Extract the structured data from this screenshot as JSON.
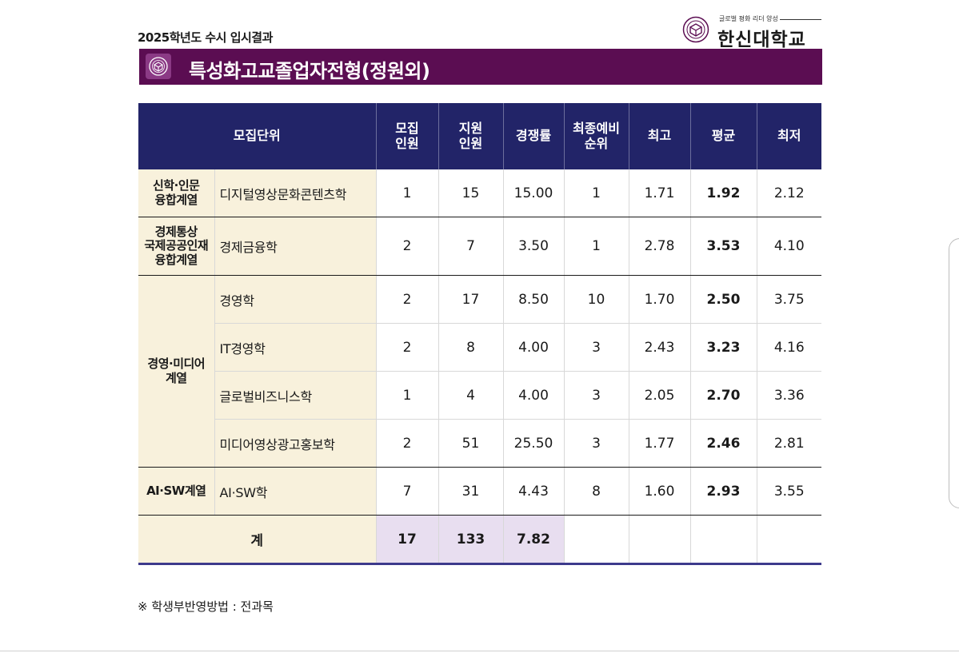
{
  "header": {
    "title": "2025학년도 수시 입시결과",
    "logo_slogan": "글로벌 평화 리더 양성",
    "logo_name": "한신대학교"
  },
  "banner": {
    "title": "특성화고교졸업자전형(정원외)"
  },
  "table": {
    "columns": {
      "unit": "모집단위",
      "quota": [
        "모집",
        "인원"
      ],
      "applicants": [
        "지원",
        "인원"
      ],
      "ratio": "경쟁률",
      "waitlist": [
        "최종예비",
        "순위"
      ],
      "max": "최고",
      "avg": "평균",
      "min": "최저"
    },
    "groups": [
      {
        "category": [
          "신학·인문",
          "융합계열"
        ],
        "rows": [
          {
            "dept": "디지털영상문화콘텐츠학",
            "quota": "1",
            "applicants": "15",
            "ratio": "15.00",
            "waitlist": "1",
            "max": "1.71",
            "avg": "1.92",
            "min": "2.12"
          }
        ]
      },
      {
        "category": [
          "경제통상",
          "국제공공인재",
          "융합계열"
        ],
        "rows": [
          {
            "dept": "경제금융학",
            "quota": "2",
            "applicants": "7",
            "ratio": "3.50",
            "waitlist": "1",
            "max": "2.78",
            "avg": "3.53",
            "min": "4.10"
          }
        ]
      },
      {
        "category": [
          "경영·미디어",
          "계열"
        ],
        "rows": [
          {
            "dept": "경영학",
            "quota": "2",
            "applicants": "17",
            "ratio": "8.50",
            "waitlist": "10",
            "max": "1.70",
            "avg": "2.50",
            "min": "3.75"
          },
          {
            "dept": "IT경영학",
            "quota": "2",
            "applicants": "8",
            "ratio": "4.00",
            "waitlist": "3",
            "max": "2.43",
            "avg": "3.23",
            "min": "4.16"
          },
          {
            "dept": "글로벌비즈니스학",
            "quota": "1",
            "applicants": "4",
            "ratio": "4.00",
            "waitlist": "3",
            "max": "2.05",
            "avg": "2.70",
            "min": "3.36"
          },
          {
            "dept": "미디어영상광고홍보학",
            "quota": "2",
            "applicants": "51",
            "ratio": "25.50",
            "waitlist": "3",
            "max": "1.77",
            "avg": "2.46",
            "min": "2.81"
          }
        ]
      },
      {
        "category": [
          "AI·SW계열"
        ],
        "rows": [
          {
            "dept": "AI·SW학",
            "quota": "7",
            "applicants": "31",
            "ratio": "4.43",
            "waitlist": "8",
            "max": "1.60",
            "avg": "2.93",
            "min": "3.55"
          }
        ]
      }
    ],
    "total": {
      "label": "계",
      "quota": "17",
      "applicants": "133",
      "ratio": "7.82"
    }
  },
  "note": "※ 학생부반영방법 : 전과목",
  "colors": {
    "header_bg": "#222468",
    "banner_bg": "#5b0d52",
    "category_bg": "#f8f1dc",
    "total_bg": "#e8def0"
  }
}
